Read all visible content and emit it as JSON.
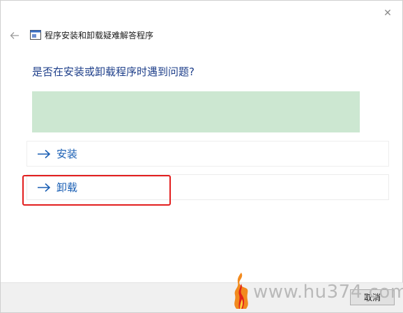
{
  "window": {
    "close_glyph": "✕"
  },
  "header": {
    "title": "程序安装和卸载疑难解答程序",
    "back_icon": "arrow-left-icon",
    "app_icon": "troubleshooter-app-icon"
  },
  "main": {
    "question": "是否在安装或卸载程序时遇到问题?",
    "options": [
      {
        "label": "安装",
        "icon": "arrow-right-icon"
      },
      {
        "label": "卸载",
        "icon": "arrow-right-icon"
      }
    ]
  },
  "footer": {
    "cancel_label": "取消"
  },
  "watermark": {
    "text": "www.hu374.com"
  },
  "colors": {
    "question": "#1e3f8a",
    "link": "#1a5fb4",
    "banner": "#cce7d1",
    "highlight": "#e21d1d",
    "footer_bg": "#f0f0f0"
  }
}
